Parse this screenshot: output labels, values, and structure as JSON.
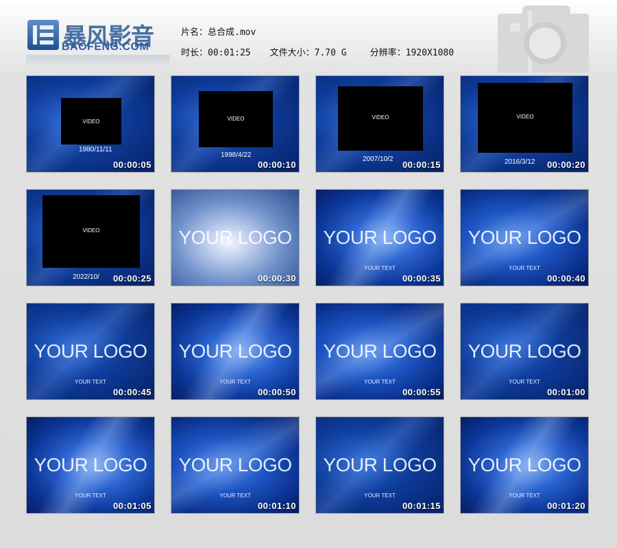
{
  "brand": {
    "name_cn": "暴风影音",
    "name_en": "BAOFENG.COM",
    "icon": "baofeng-logo-icon"
  },
  "info": {
    "title_label": "片名：",
    "title_value": "总合成.mov",
    "duration_label": "时长：",
    "duration_value": "00:01:25",
    "size_label": "文件大小：",
    "size_value": "7.70 G",
    "resolution_label": "分辨率：",
    "resolution_value": "1920X1080"
  },
  "camera_icon": "camera-icon",
  "colors": {
    "thumb_blue": "#0b3595",
    "timestamp": "#ffffff",
    "page_bg": "#dcdcdc"
  },
  "thumbnails": [
    {
      "kind": "video",
      "video_label": "VIDEO",
      "date": "1980/11/11",
      "time": "00:00:05"
    },
    {
      "kind": "video",
      "video_label": "VIDEO",
      "date": "1998/4/22",
      "time": "00:00:10"
    },
    {
      "kind": "video",
      "video_label": "VIDEO",
      "date": "2007/10/2",
      "time": "00:00:15"
    },
    {
      "kind": "video",
      "video_label": "VIDEO",
      "date": "2016/3/12",
      "time": "00:00:20"
    },
    {
      "kind": "video",
      "video_label": "VIDEO",
      "date": "2022/10/",
      "time": "00:00:25"
    },
    {
      "kind": "logo",
      "logo": "YOUR LOGO",
      "sub": "",
      "time": "00:00:30"
    },
    {
      "kind": "logo",
      "logo": "YOUR LOGO",
      "sub": "YOUR TEXT",
      "time": "00:00:35"
    },
    {
      "kind": "logo",
      "logo": "YOUR LOGO",
      "sub": "YOUR TEXT",
      "time": "00:00:40"
    },
    {
      "kind": "logo",
      "logo": "YOUR LOGO",
      "sub": "YOUR TEXT",
      "time": "00:00:45"
    },
    {
      "kind": "logo",
      "logo": "YOUR LOGO",
      "sub": "YOUR TEXT",
      "time": "00:00:50"
    },
    {
      "kind": "logo",
      "logo": "YOUR LOGO",
      "sub": "YOUR TEXT",
      "time": "00:00:55"
    },
    {
      "kind": "logo",
      "logo": "YOUR LOGO",
      "sub": "YOUR TEXT",
      "time": "00:01:00"
    },
    {
      "kind": "logo",
      "logo": "YOUR LOGO",
      "sub": "YOUR TEXT",
      "time": "00:01:05"
    },
    {
      "kind": "logo",
      "logo": "YOUR LOGO",
      "sub": "YOUR TEXT",
      "time": "00:01:10"
    },
    {
      "kind": "logo",
      "logo": "YOUR LOGO",
      "sub": "YOUR TEXT",
      "time": "00:01:15"
    },
    {
      "kind": "logo",
      "logo": "YOUR LOGO",
      "sub": "YOUR TEXT",
      "time": "00:01:20"
    }
  ]
}
